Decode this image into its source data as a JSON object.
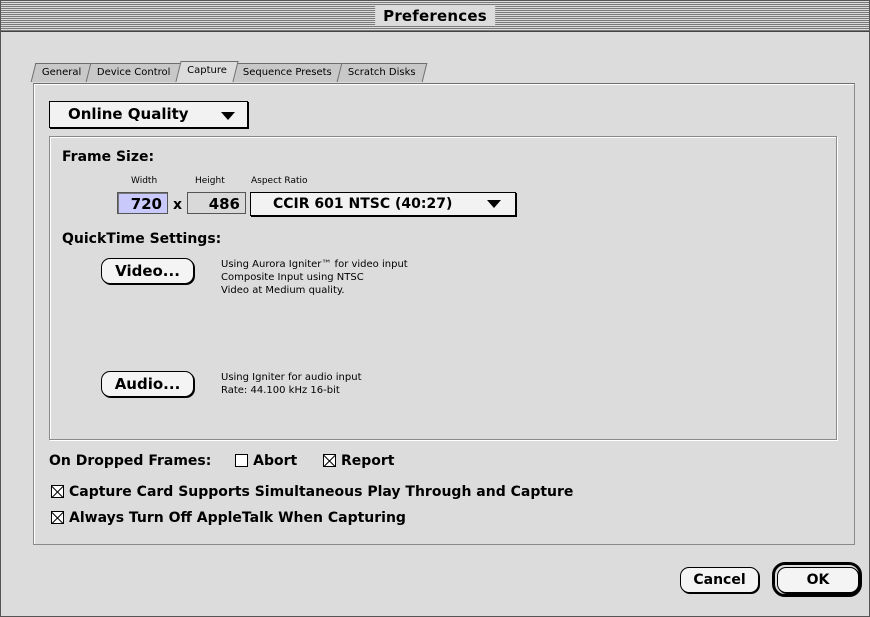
{
  "window": {
    "title": "Preferences"
  },
  "tabs": [
    {
      "label": "General",
      "active": false
    },
    {
      "label": "Device Control",
      "active": false
    },
    {
      "label": "Capture",
      "active": true
    },
    {
      "label": "Sequence Presets",
      "active": false
    },
    {
      "label": "Scratch Disks",
      "active": false
    }
  ],
  "capture": {
    "quality_popup": "Online Quality",
    "frame_size": {
      "heading": "Frame Size:",
      "width_label": "Width",
      "height_label": "Height",
      "aspect_label": "Aspect Ratio",
      "width_value": "720",
      "times": "x",
      "height_value": "486",
      "aspect_value": "CCIR 601 NTSC (40:27)"
    },
    "quicktime": {
      "heading": "QuickTime Settings:",
      "video_button": "Video...",
      "video_desc": [
        "Using Aurora Igniter™ for video input",
        "Composite Input using NTSC",
        "Video at Medium quality."
      ],
      "audio_button": "Audio...",
      "audio_desc": [
        "Using Igniter for audio input",
        "Rate: 44.100 kHz 16-bit"
      ]
    },
    "dropped_frames": {
      "label": "On Dropped Frames:",
      "abort_label": "Abort",
      "abort_checked": false,
      "report_label": "Report",
      "report_checked": true
    },
    "play_through": {
      "label": "Capture Card Supports Simultaneous Play Through and Capture",
      "checked": true
    },
    "appletalk": {
      "label": "Always Turn Off AppleTalk When Capturing",
      "checked": true
    }
  },
  "buttons": {
    "cancel": "Cancel",
    "ok": "OK"
  },
  "icons": {
    "popup_arrow": "triangle-down-icon",
    "checkbox_mark": "x-mark-icon"
  },
  "colors": {
    "window_bg": "#dcdcdc",
    "focused_field": "#c9c9fb"
  }
}
